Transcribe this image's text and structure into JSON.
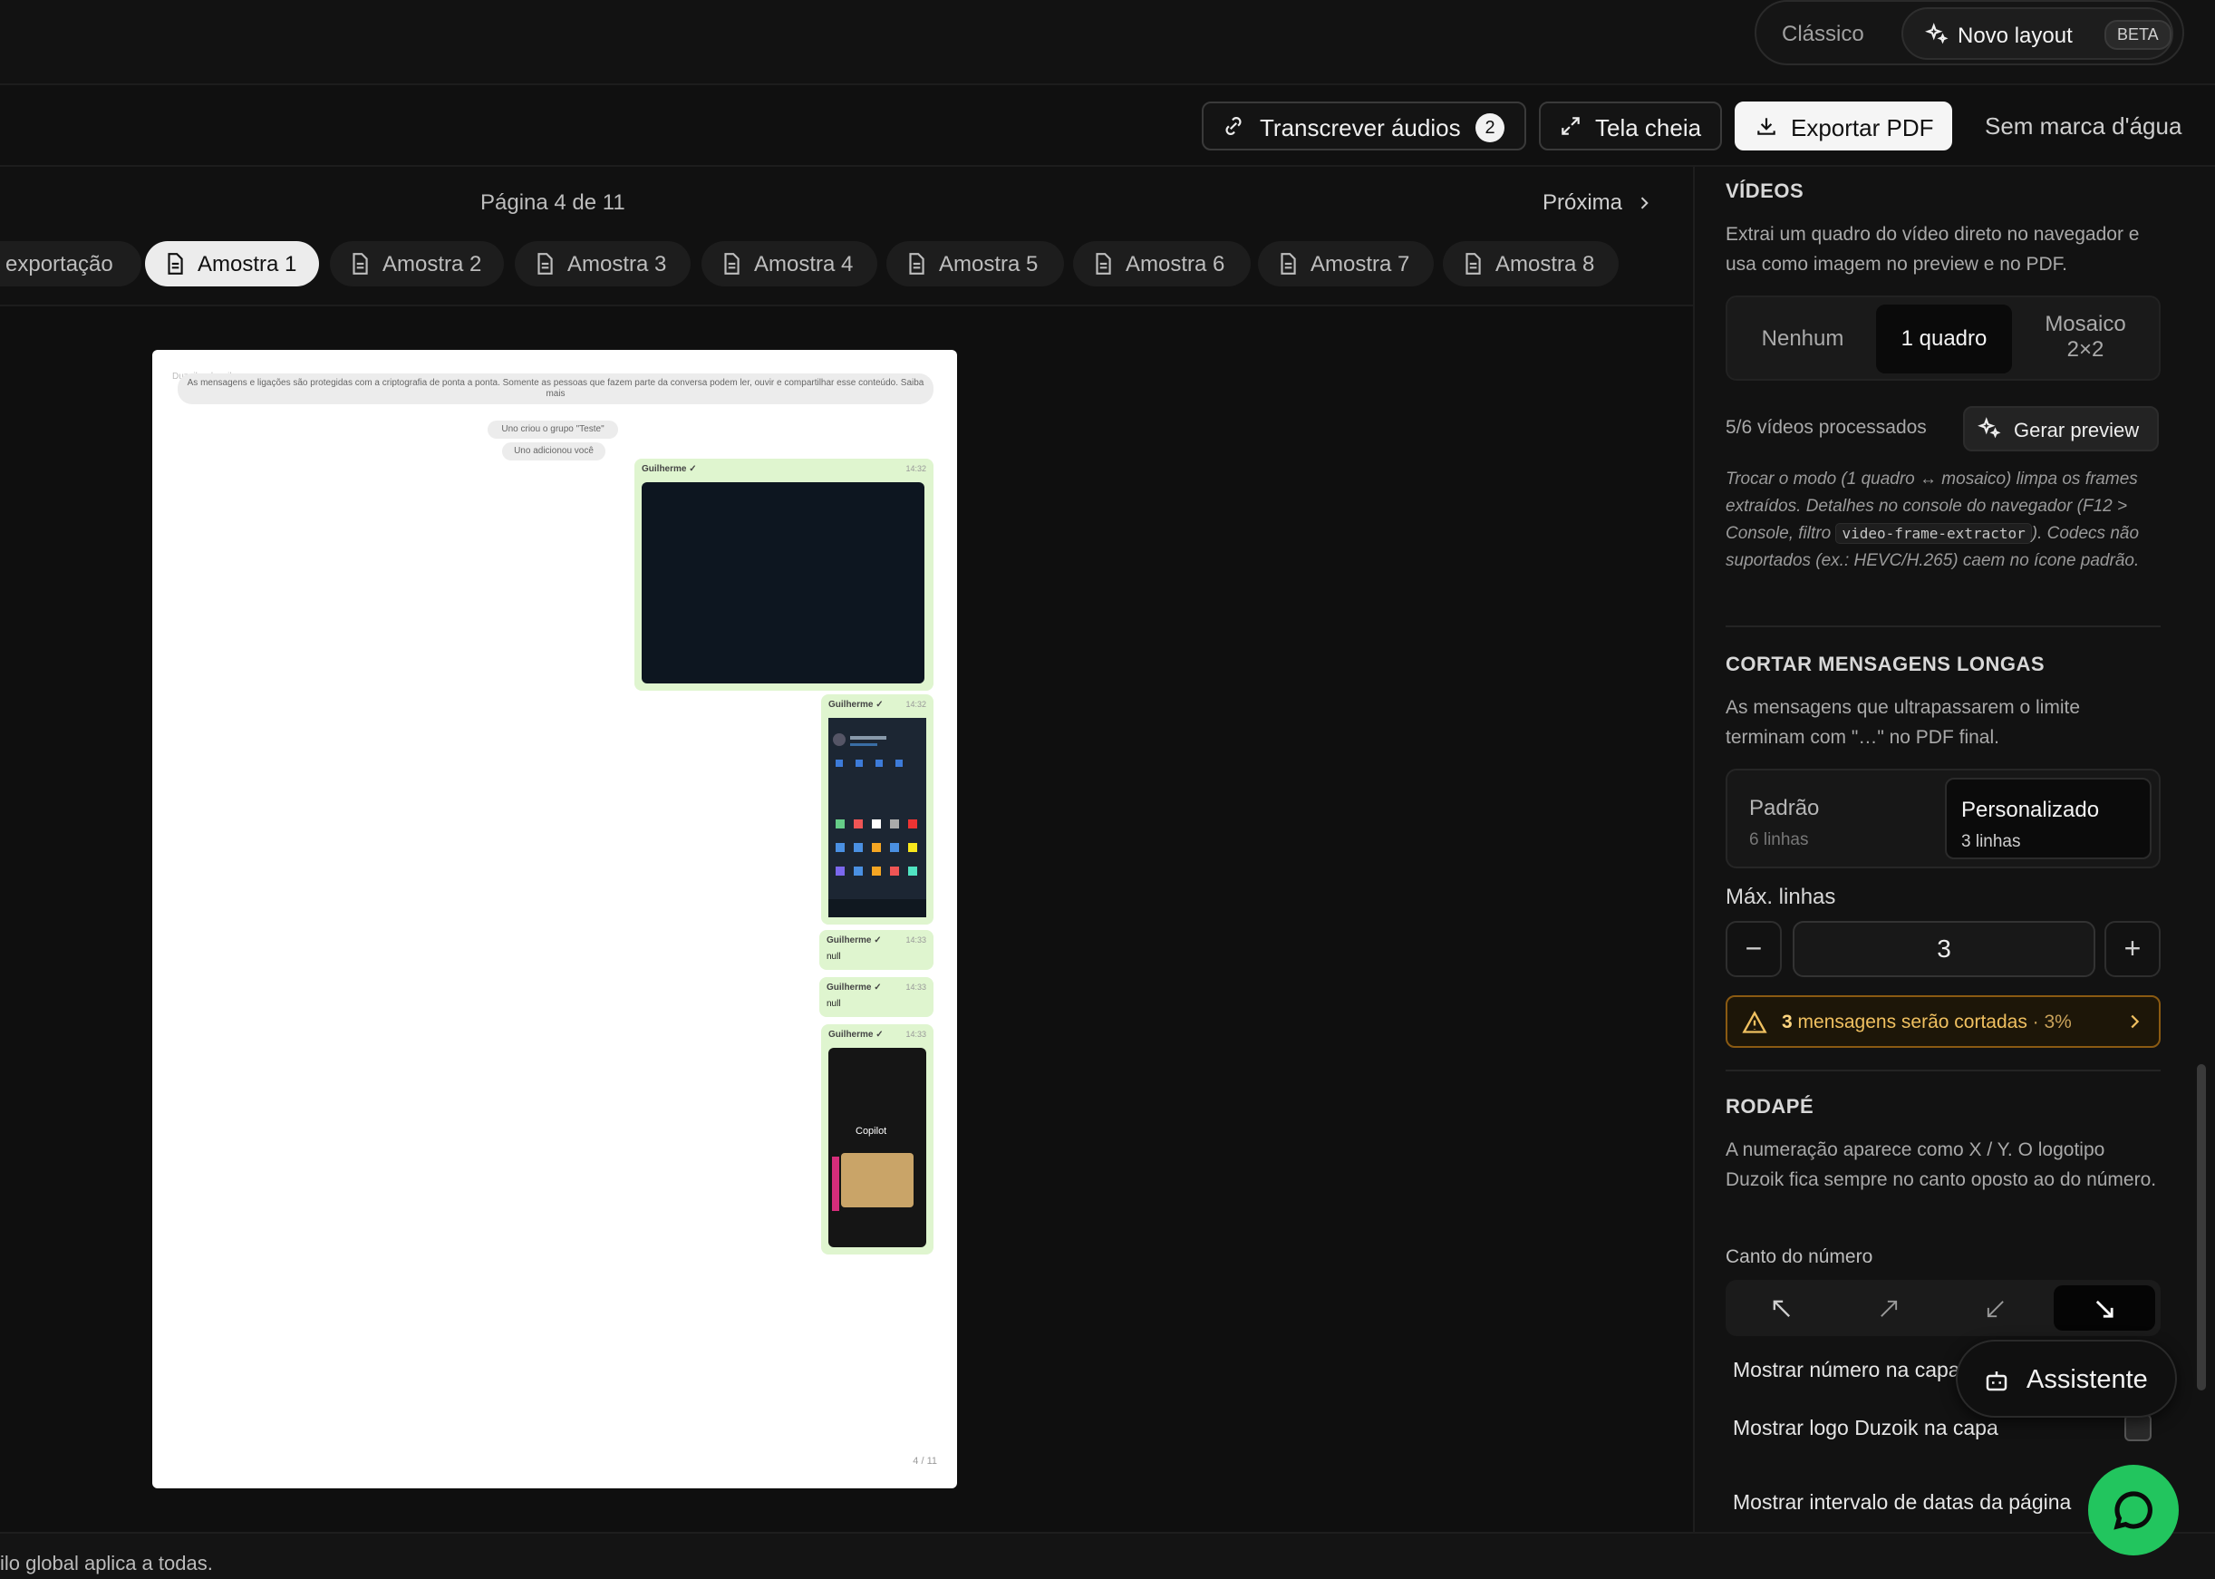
{
  "topbar": {
    "classic_label": "Clássico",
    "new_layout_label": "Novo layout",
    "beta_badge": "BETA"
  },
  "toolbar": {
    "transcribe_label": "Transcrever áudios",
    "transcribe_count": "2",
    "fullscreen_label": "Tela cheia",
    "export_label": "Exportar PDF",
    "no_watermark_label": "Sem marca d'água"
  },
  "preview": {
    "page_indicator": "Página 4 de 11",
    "next_label": "Próxima",
    "samples": [
      "exportação",
      "Amostra 1",
      "Amostra 2",
      "Amostra 3",
      "Amostra 4",
      "Amostra 5",
      "Amostra 6",
      "Amostra 7",
      "Amostra 8"
    ],
    "active_sample": "Amostra 1"
  },
  "page": {
    "header": "Duzoik · duzoik.app",
    "system_notice": "As mensagens e ligações são protegidas com a criptografia de ponta a ponta. Somente as pessoas que fazem parte da conversa podem ler, ouvir e compartilhar esse conteúdo. Saiba mais",
    "system_group": "Uno criou o grupo \"Teste\"",
    "system_added": "Uno adicionou você",
    "sender": "Guilherme ✓",
    "times": [
      "14:32",
      "14:32",
      "14:33",
      "14:33",
      "14:33"
    ],
    "null_msg": "null",
    "copilot": "Copilot",
    "page_number": "4 / 11"
  },
  "footer": {
    "text": "ilo global aplica a todas."
  },
  "panel": {
    "videos": {
      "heading": "VÍDEOS",
      "description": "Extrai um quadro do vídeo direto no navegador e usa como imagem no preview e no PDF.",
      "options": [
        "Nenhum",
        "1 quadro",
        "Mosaico",
        "2×2"
      ],
      "processed": "5/6 vídeos processados",
      "generate_label": "Gerar preview",
      "note_1": "Trocar o modo (1 quadro ↔ mosaico) limpa os frames extraídos. Detalhes no console do navegador (F12 > Console, filtro ",
      "note_code": "video-frame-extractor",
      "note_2": "). Codecs não suportados (ex.: HEVC/H.265) caem no ícone padrão."
    },
    "cut": {
      "heading": "CORTAR MENSAGENS LONGAS",
      "description": "As mensagens que ultrapassarem o limite terminam com \"…\" no PDF final.",
      "default_label": "Padrão",
      "default_sub": "6 linhas",
      "custom_label": "Personalizado",
      "custom_sub": "3 linhas",
      "max_label": "Máx. linhas",
      "max_value": "3",
      "warn_count": "3",
      "warn_text": " mensagens serão cortadas",
      "warn_pct": " · 3%"
    },
    "footer": {
      "heading": "RODAPÉ",
      "description": "A numeração aparece como X  /  Y. O logotipo Duzoik fica sempre no canto oposto ao do número.",
      "corner_label": "Canto do número",
      "show_number_cover": "Mostrar número na capa",
      "show_logo_cover": "Mostrar logo Duzoik na capa",
      "show_date_range": "Mostrar intervalo de datas da página"
    }
  },
  "assistant_label": "Assistente"
}
